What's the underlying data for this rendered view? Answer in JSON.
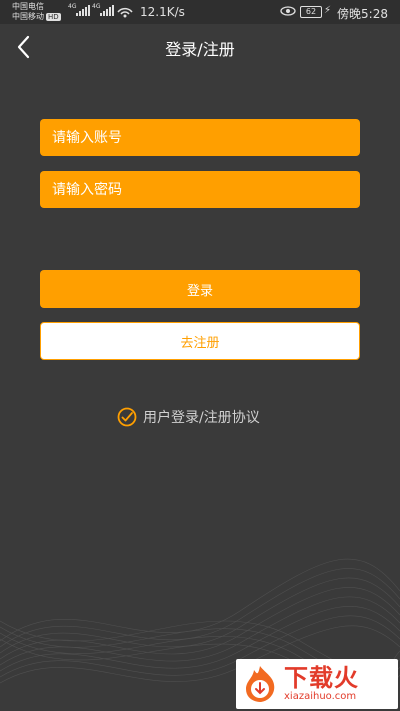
{
  "status_bar": {
    "carrier_1": "中国电信",
    "carrier_2": "中国移动",
    "carrier_hd": "HD",
    "net_1": "4G",
    "net_2": "4G",
    "speed": "12.1K/s",
    "battery": "62",
    "time": "傍晚5:28"
  },
  "header": {
    "title": "登录/注册"
  },
  "form": {
    "account_placeholder": "请输入账号",
    "password_placeholder": "请输入密码",
    "login_label": "登录",
    "register_label": "去注册"
  },
  "agreement": {
    "label": "用户登录/注册协议",
    "checked": true
  },
  "watermark": {
    "name": "下载火",
    "url": "xiazaihuo.com"
  },
  "colors": {
    "accent": "#ff9f00",
    "background": "#3a3a3a"
  }
}
